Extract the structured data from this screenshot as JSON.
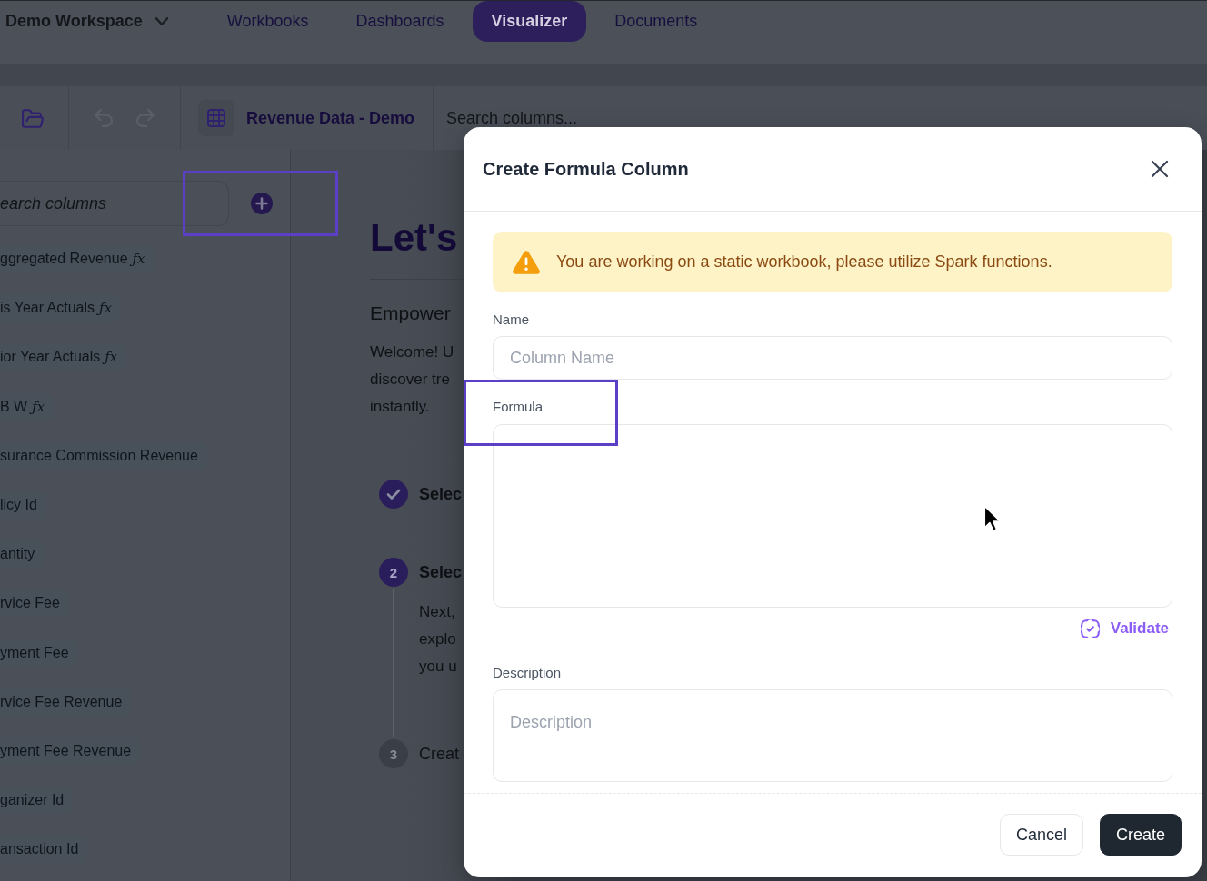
{
  "topbar": {
    "workspace": "Demo Workspace",
    "tabs": [
      {
        "label": "Workbooks",
        "selected": false
      },
      {
        "label": "Dashboards",
        "selected": false
      },
      {
        "label": "Visualizer",
        "selected": true
      },
      {
        "label": "Documents",
        "selected": false
      }
    ]
  },
  "toolbar": {
    "dataset": "Revenue Data - Demo",
    "search": {
      "placeholder": "Search columns..."
    }
  },
  "sidebar": {
    "search": {
      "placeholder": "earch columns"
    },
    "add_button": {
      "highlighted": true
    },
    "columns": [
      {
        "label": "ggregated Revenue",
        "badge": "ƒx"
      },
      {
        "label": "is Year Actuals",
        "badge": "ƒx"
      },
      {
        "label": "ior Year Actuals",
        "badge": "ƒx"
      },
      {
        "label": "B W",
        "badge": "ƒx"
      },
      {
        "label": "surance Commission Revenue"
      },
      {
        "label": "licy Id"
      },
      {
        "label": "antity"
      },
      {
        "label": "rvice Fee"
      },
      {
        "label": "yment Fee"
      },
      {
        "label": "rvice Fee Revenue"
      },
      {
        "label": "yment Fee Revenue"
      },
      {
        "label": "ganizer Id"
      },
      {
        "label": "ansaction Id"
      }
    ]
  },
  "welcome": {
    "title": "Let's",
    "subtitle": "Empower",
    "text_lines": [
      "Welcome! U",
      "discover tre",
      "instantly."
    ],
    "steps": [
      {
        "completed": true,
        "current": false,
        "title": "Selec"
      },
      {
        "completed": false,
        "current": true,
        "number": "2",
        "title": "Selec",
        "text_lines": [
          "Next,",
          "explo",
          "you u"
        ]
      },
      {
        "completed": false,
        "current": false,
        "number": "3",
        "title": "Creat"
      }
    ]
  },
  "dialog": {
    "title": "Create Formula Column",
    "alert": "You are working on a static workbook, please utilize Spark functions.",
    "fields": [
      {
        "kind": "input",
        "label": "Name",
        "placeholder": "Column Name",
        "highlighted": false
      },
      {
        "kind": "formula",
        "label": "Formula",
        "action": "Validate",
        "highlighted": true
      },
      {
        "kind": "textarea",
        "label": "Description",
        "placeholder": "Description",
        "highlighted": false
      }
    ],
    "buttons": [
      {
        "label": "Cancel",
        "primary": false
      },
      {
        "label": "Create",
        "primary": true
      }
    ]
  }
}
